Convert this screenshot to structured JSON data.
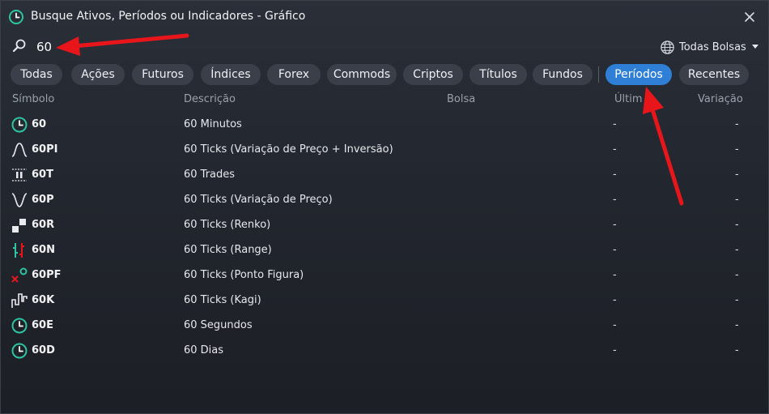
{
  "window": {
    "title": "Busque Ativos, Períodos ou Indicadores - Gráfico"
  },
  "search": {
    "value": "60"
  },
  "exchange": {
    "label": "Todas Bolsas"
  },
  "tabs": [
    {
      "label": "Todas"
    },
    {
      "label": "Ações"
    },
    {
      "label": "Futuros"
    },
    {
      "label": "Índices"
    },
    {
      "label": "Forex"
    },
    {
      "label": "Commods"
    },
    {
      "label": "Criptos"
    },
    {
      "label": "Títulos"
    },
    {
      "label": "Fundos"
    },
    {
      "label": "Períodos",
      "active": true
    },
    {
      "label": "Recentes"
    }
  ],
  "columns": {
    "symbol": "Símbolo",
    "description": "Descrição",
    "exchange": "Bolsa",
    "last": "Últim",
    "change": "Variação"
  },
  "rows": [
    {
      "symbol": "60",
      "description": "60 Minutos",
      "last": "-",
      "change": "-",
      "icon": "clock-icon"
    },
    {
      "symbol": "60PI",
      "description": "60 Ticks (Variação de Preço + Inversão)",
      "last": "-",
      "change": "-",
      "icon": "bell-curve-icon"
    },
    {
      "symbol": "60T",
      "description": "60 Trades",
      "last": "-",
      "change": "-",
      "icon": "trades-icon"
    },
    {
      "symbol": "60P",
      "description": "60 Ticks (Variação de Preço)",
      "last": "-",
      "change": "-",
      "icon": "price-variation-icon"
    },
    {
      "symbol": "60R",
      "description": "60 Ticks (Renko)",
      "last": "-",
      "change": "-",
      "icon": "renko-icon"
    },
    {
      "symbol": "60N",
      "description": "60 Ticks (Range)",
      "last": "-",
      "change": "-",
      "icon": "range-icon"
    },
    {
      "symbol": "60PF",
      "description": "60 Ticks (Ponto Figura)",
      "last": "-",
      "change": "-",
      "icon": "point-figure-icon"
    },
    {
      "symbol": "60K",
      "description": "60 Ticks (Kagi)",
      "last": "-",
      "change": "-",
      "icon": "kagi-icon"
    },
    {
      "symbol": "60E",
      "description": "60 Segundos",
      "last": "-",
      "change": "-",
      "icon": "clock-icon"
    },
    {
      "symbol": "60D",
      "description": "60 Dias",
      "last": "-",
      "change": "-",
      "icon": "clock-icon"
    }
  ],
  "colors": {
    "accent": "#2f7fd7",
    "clock": "#2ec4a0",
    "annotation_arrow": "#e8161b"
  }
}
